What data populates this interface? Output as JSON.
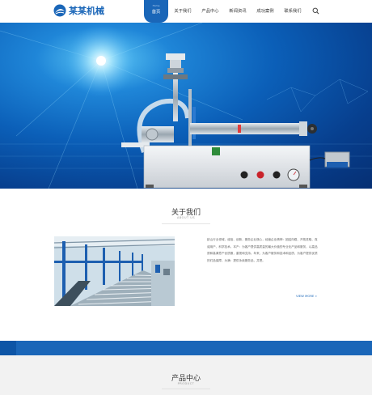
{
  "header": {
    "logo_text": "某某机械",
    "nav": [
      {
        "label": "首页",
        "sublabel": "Home",
        "active": true
      },
      {
        "label": "关于我们"
      },
      {
        "label": "产品中心"
      },
      {
        "label": "新闻资讯"
      },
      {
        "label": "成功案例"
      },
      {
        "label": "联系我们"
      }
    ],
    "search_icon": "search-icon"
  },
  "banner": {
    "slides": 2,
    "active_slide": 2
  },
  "about": {
    "title": "关于我们",
    "subtitle": "ABOUT US",
    "text": "蚌山行业领域，诚信、创新，服务企业核心，经营企业精神：团结向稳、开拓进取、真诚用户、科学技术。本产：为客户提供高质量的最大价值的专业化产品和服务，以高品质和高满意产优质服，重视和支持。年来，为客户服务和技术和品质，为客户提供优质的们品保障，为满：提供永续服务品，并把。",
    "more_label": "VIEW MORE »"
  },
  "products": {
    "title": "产品中心",
    "subtitle": "PRODUCT"
  },
  "colors": {
    "brand": "#1a66b8",
    "banner_dark": "#062f73",
    "banner_light": "#5ec8f5"
  }
}
